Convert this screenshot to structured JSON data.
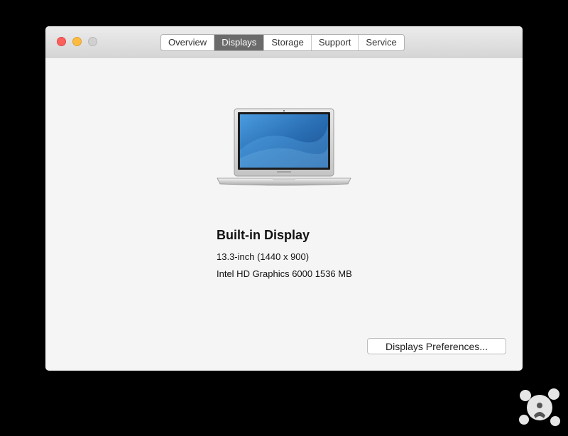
{
  "window": {
    "traffic_lights": [
      "close",
      "minimize",
      "zoom"
    ],
    "tabs": [
      {
        "label": "Overview",
        "active": false
      },
      {
        "label": "Displays",
        "active": true
      },
      {
        "label": "Storage",
        "active": false
      },
      {
        "label": "Support",
        "active": false
      },
      {
        "label": "Service",
        "active": false
      }
    ]
  },
  "display": {
    "image_icon": "laptop-icon",
    "name": "Built-in Display",
    "size": "13.3-inch (1440 x 900)",
    "graphics": "Intel HD Graphics 6000 1536 MB"
  },
  "actions": {
    "preferences_label": "Displays Preferences..."
  },
  "colors": {
    "close": "#fc605c",
    "minimize": "#fdbc40",
    "zoom": "#d0d0d0",
    "active_tab": "#6b6b6b",
    "screen": "#2a6fb4"
  },
  "watermark": {
    "icon": "watermark-logo-icon"
  }
}
